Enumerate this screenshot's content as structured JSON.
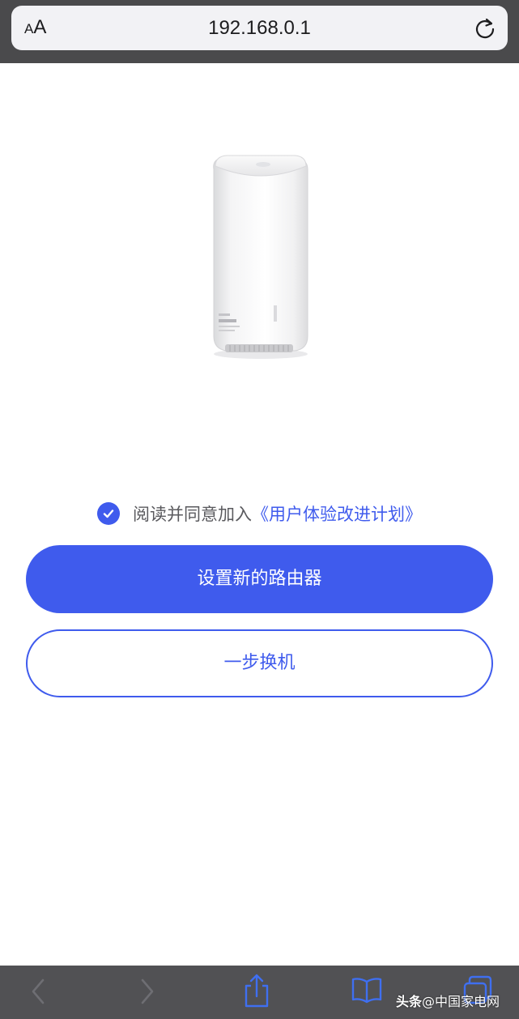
{
  "browser": {
    "text_size_small": "A",
    "text_size_large": "A",
    "url": "192.168.0.1",
    "reload_icon": "reload-icon"
  },
  "agreement": {
    "checked": true,
    "text": "阅读并同意加入",
    "link": "《用户体验改进计划》"
  },
  "actions": {
    "setup_new_router": "设置新的路由器",
    "one_step_replace": "一步换机"
  },
  "toolbar": {
    "icons": [
      "back-icon",
      "forward-icon",
      "share-icon",
      "bookmarks-icon",
      "tabs-icon"
    ]
  },
  "watermark": {
    "brand": "头条",
    "handle": "@中国家电网"
  },
  "colors": {
    "accent": "#3f5bed",
    "top_bar": "#4a4a4c",
    "bottom_bar": "#515154"
  }
}
